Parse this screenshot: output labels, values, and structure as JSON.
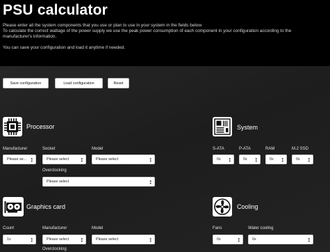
{
  "page": {
    "title": "PSU calculator",
    "intro": [
      "Please enter all the system components that you use or plan to use in your system in the fields below.",
      "To calculate the correct wattage of the power supply we use the peak power consumption of each component in your configuration according to the",
      "manufacturer's information.",
      "You can save your configuration and load it anytime if needed."
    ]
  },
  "buttons": {
    "save": "Save configuration",
    "load": "Load configuration",
    "reset": "Reset"
  },
  "processor": {
    "title": "Processor",
    "manufacturer_label": "Manufacturer",
    "manufacturer_value": "Please se...",
    "socket_label": "Socket",
    "socket_value": "Please select",
    "model_label": "Model",
    "model_value": "Please select",
    "overclocking_label": "Overclocking",
    "overclocking_value": "Please select"
  },
  "system": {
    "title": "System",
    "sata_label": "S-ATA",
    "sata_value": "0x",
    "pata_label": "P-ATA",
    "pata_value": "0x",
    "ram_label": "RAM",
    "ram_value": "0x",
    "m2_label": "M.2 SSD",
    "m2_value": "0x"
  },
  "graphics": {
    "title": "Graphics card",
    "count_label": "Count",
    "count_value": "1x",
    "manufacturer_label": "Manufacturer",
    "manufacturer_value": "Please select",
    "model_label": "Model",
    "model_value": "Please select",
    "overclocking_label": "Overclocking"
  },
  "cooling": {
    "title": "Cooling",
    "fans_label": "Fans",
    "fans_value": "0x",
    "water_label": "Water cooling",
    "water_value": "0x"
  },
  "icons": {
    "processor": "cpu-chip-icon",
    "system": "motherboard-icon",
    "graphics": "graphics-card-icon",
    "cooling": "fan-icon",
    "select_arrow": "up-down-chevron-icon"
  },
  "colors": {
    "background": "#0c0c0c",
    "panel": "#222222",
    "button": "#ffffff"
  }
}
